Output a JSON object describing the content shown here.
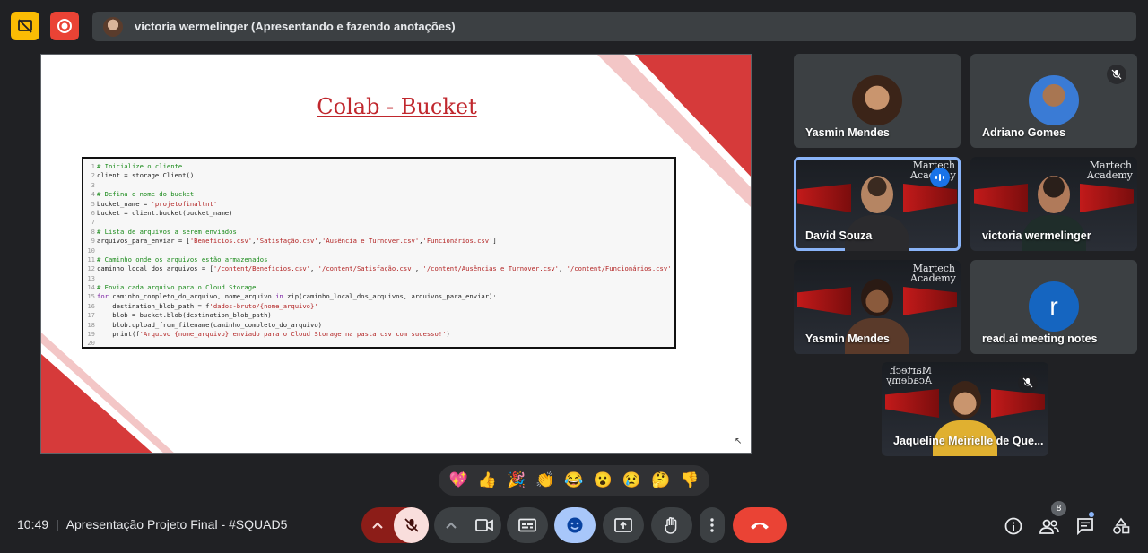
{
  "presenter": {
    "label": "victoria wermelinger (Apresentando e fazendo anotações)"
  },
  "slide": {
    "title": "Colab - Bucket",
    "code_lines": [
      {
        "n": "1",
        "parts": [
          [
            "cm",
            "# Inicialize o cliente"
          ]
        ]
      },
      {
        "n": "2",
        "parts": [
          [
            "",
            "client = storage.Client()"
          ]
        ]
      },
      {
        "n": "3",
        "parts": [
          [
            "",
            ""
          ]
        ]
      },
      {
        "n": "4",
        "parts": [
          [
            "cm",
            "# Defina o nome do bucket"
          ]
        ]
      },
      {
        "n": "5",
        "parts": [
          [
            "",
            "bucket_name = "
          ],
          [
            "st",
            "'projetofinaltnt'"
          ]
        ]
      },
      {
        "n": "6",
        "parts": [
          [
            "",
            "bucket = client.bucket(bucket_name)"
          ]
        ]
      },
      {
        "n": "7",
        "parts": [
          [
            "",
            ""
          ]
        ]
      },
      {
        "n": "8",
        "parts": [
          [
            "cm",
            "# Lista de arquivos a serem enviados"
          ]
        ]
      },
      {
        "n": "9",
        "parts": [
          [
            "",
            "arquivos_para_enviar = ["
          ],
          [
            "st",
            "'Benefícios.csv'"
          ],
          [
            "",
            ","
          ],
          [
            "st",
            "'Satisfação.csv'"
          ],
          [
            "",
            ","
          ],
          [
            "st",
            "'Ausência e Turnover.csv'"
          ],
          [
            "",
            ","
          ],
          [
            "st",
            "'Funcionários.csv'"
          ],
          [
            "",
            "]"
          ]
        ]
      },
      {
        "n": "10",
        "parts": [
          [
            "",
            ""
          ]
        ]
      },
      {
        "n": "11",
        "parts": [
          [
            "cm",
            "# Caminho onde os arquivos estão armazenados"
          ]
        ]
      },
      {
        "n": "12",
        "parts": [
          [
            "",
            "caminho_local_dos_arquivos = ["
          ],
          [
            "st",
            "'/content/Benefícios.csv'"
          ],
          [
            "",
            ", "
          ],
          [
            "st",
            "'/content/Satisfação.csv'"
          ],
          [
            "",
            ", "
          ],
          [
            "st",
            "'/content/Ausências e Turnover.csv'"
          ],
          [
            "",
            ", "
          ],
          [
            "st",
            "'/content/Funcionários.csv'"
          ],
          [
            "",
            "]"
          ]
        ]
      },
      {
        "n": "13",
        "parts": [
          [
            "",
            ""
          ]
        ]
      },
      {
        "n": "14",
        "parts": [
          [
            "cm",
            "# Envia cada arquivo para o Cloud Storage"
          ]
        ]
      },
      {
        "n": "15",
        "parts": [
          [
            "kw",
            "for"
          ],
          [
            "",
            " caminho_completo_do_arquivo, nome_arquivo "
          ],
          [
            "kw",
            "in"
          ],
          [
            "",
            " zip(caminho_local_dos_arquivos, arquivos_para_enviar):"
          ]
        ]
      },
      {
        "n": "16",
        "parts": [
          [
            "",
            "    destination_blob_path = f"
          ],
          [
            "st",
            "'dados-bruto/{nome_arquivo}'"
          ]
        ]
      },
      {
        "n": "17",
        "parts": [
          [
            "",
            "    blob = bucket.blob(destination_blob_path)"
          ]
        ]
      },
      {
        "n": "18",
        "parts": [
          [
            "",
            "    blob.upload_from_filename(caminho_completo_do_arquivo)"
          ]
        ]
      },
      {
        "n": "19",
        "parts": [
          [
            "",
            "    print(f"
          ],
          [
            "st",
            "'Arquivo {nome_arquivo} enviado para o Cloud Storage na pasta csv com sucesso!'"
          ],
          [
            "",
            ")"
          ]
        ]
      },
      {
        "n": "20",
        "parts": [
          [
            "",
            ""
          ]
        ]
      }
    ]
  },
  "participants": [
    {
      "name": "Yasmin Mendes"
    },
    {
      "name": "Adriano Gomes"
    },
    {
      "name": "David Souza"
    },
    {
      "name": "victoria wermelinger"
    },
    {
      "name": "Yasmin Mendes"
    },
    {
      "name": "read.ai meeting notes",
      "initial": "r"
    },
    {
      "name": "Jaqueline Meirielle de Que..."
    }
  ],
  "brand_text": "Martech Academy",
  "reactions": [
    "💖",
    "👍",
    "🎉",
    "👏",
    "😂",
    "😮",
    "😢",
    "🤔",
    "👎"
  ],
  "bottom": {
    "time": "10:49",
    "meeting_title": "Apresentação Projeto Final - #SQUAD5",
    "people_count": "8"
  },
  "colors": {
    "accent_red": "#ea4335",
    "accent_yellow": "#fbbc04",
    "active_blue": "#8ab4f8",
    "slide_red": "#c0272d"
  }
}
